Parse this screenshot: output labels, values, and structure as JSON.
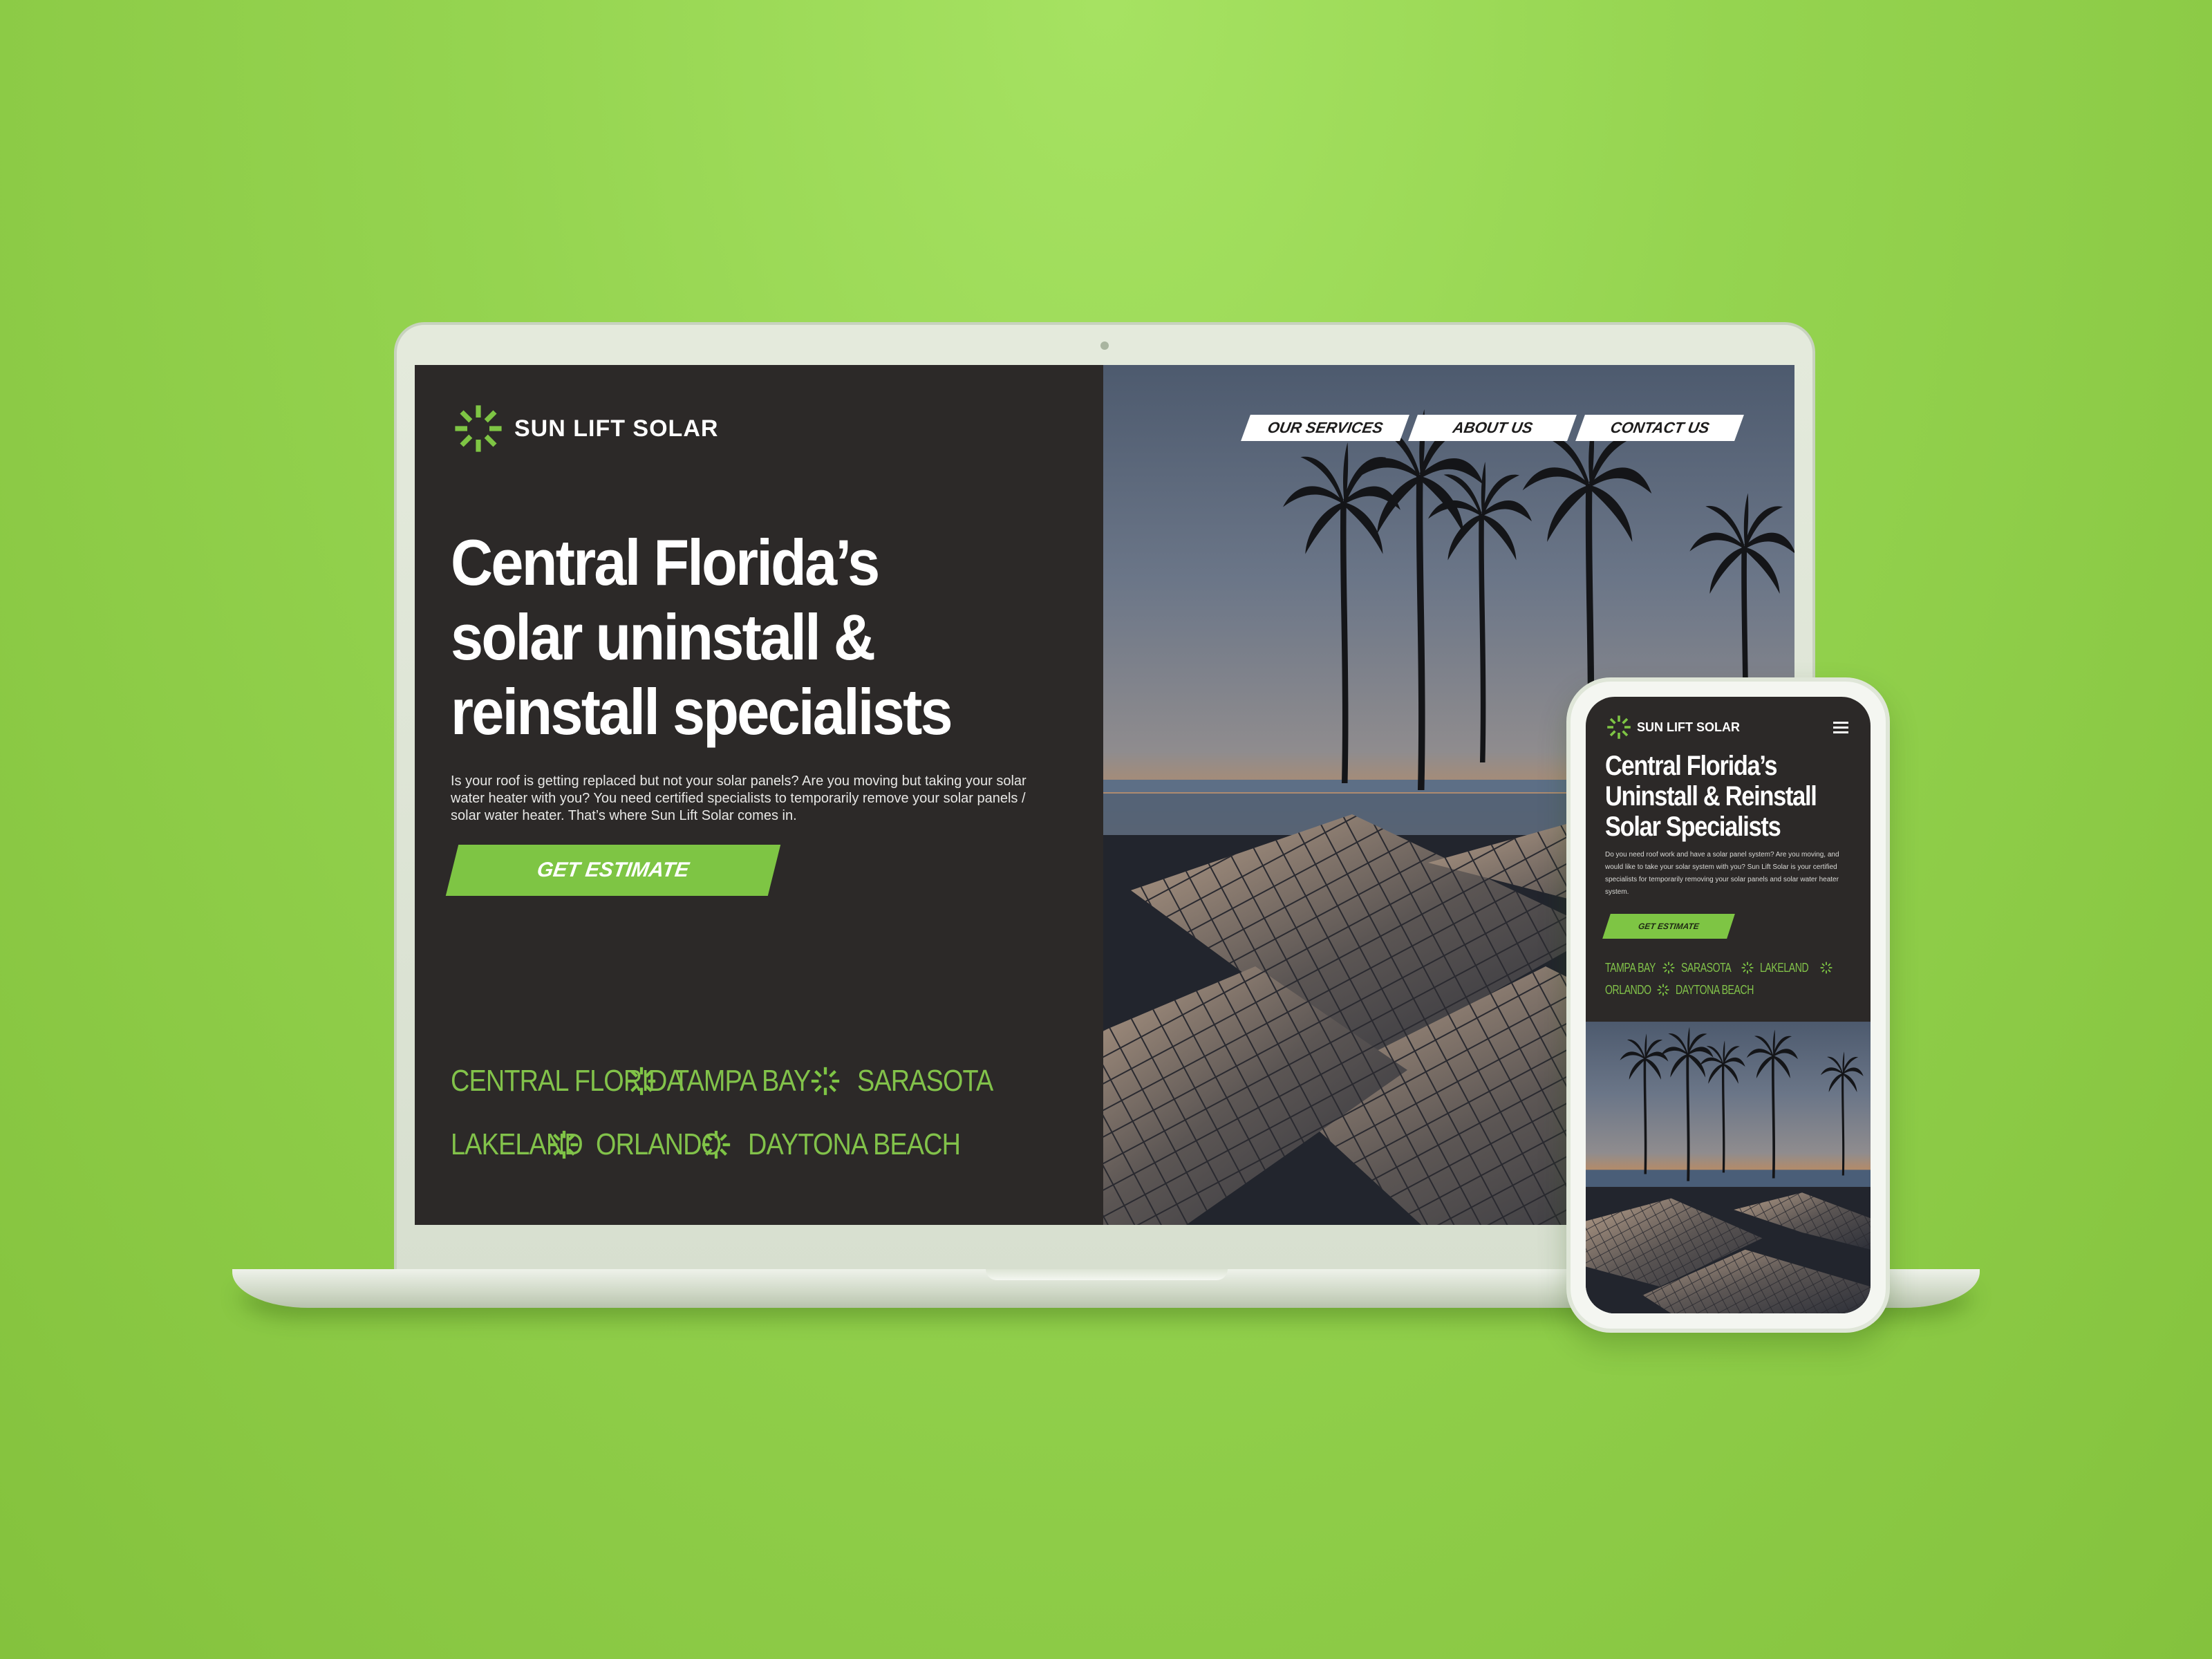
{
  "brand": {
    "name": "SUN LIFT SOLAR",
    "accent_color": "#7ec544",
    "dark_bg": "#2c2928"
  },
  "nav": {
    "items": [
      "OUR SERVICES",
      "ABOUT US",
      "CONTACT US"
    ]
  },
  "hero": {
    "headline": "Central Florida’s solar uninstall & reinstall specialists",
    "body": "Is your roof is getting replaced but not your solar panels? Are you moving but taking your solar water heater with you? You need certified specialists to temporarily remove your solar panels / solar water heater. That’s where Sun Lift Solar comes in.",
    "cta_label": "GET ESTIMATE"
  },
  "locations": {
    "row1": [
      "CENTRAL FLORIDA",
      "TAMPA BAY",
      "SARASOTA"
    ],
    "row2": [
      "LAKELAND",
      "ORLANDO",
      "DAYTONA BEACH"
    ]
  },
  "mobile": {
    "brand_name": "SUN LIFT SOLAR",
    "headline": "Central Florida’s Uninstall & Reinstall Solar Specialists",
    "body": "Do you need roof work and have a solar panel system? Are you moving, and would like to take your solar system with you? Sun Lift Solar is your certified specialists for temporarily removing your solar panels and solar water heater system.",
    "cta_label": "GET ESTIMATE",
    "locations": {
      "row1": [
        "TAMPA BAY",
        "SARASOTA",
        "LAKELAND"
      ],
      "row2": [
        "ORLANDO",
        "DAYTONA BEACH"
      ]
    },
    "menu_icon": "hamburger-icon"
  },
  "icons": {
    "logo": "sunburst-icon",
    "separator": "sunburst-icon"
  }
}
